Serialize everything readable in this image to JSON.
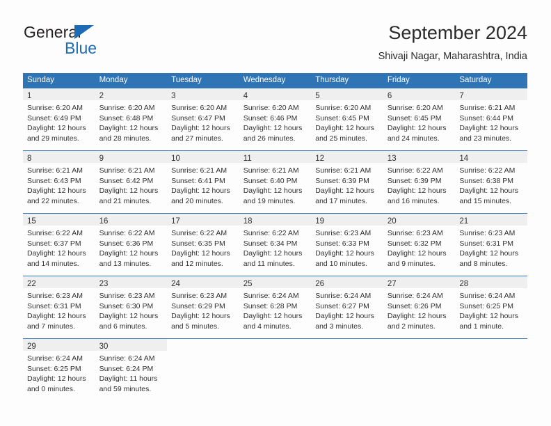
{
  "brand": {
    "name_part1": "General",
    "name_part2": "Blue",
    "flag_icon": "triangle-flag-icon",
    "accent_color": "#1d6cb5"
  },
  "header": {
    "title": "September 2024",
    "subtitle": "Shivaji Nagar, Maharashtra, India"
  },
  "theme": {
    "header_row_bg": "#2f74b5",
    "daynum_bg": "#efefef",
    "text_color": "#303030",
    "page_bg": "#fdfdfd"
  },
  "weekday_headers": [
    "Sunday",
    "Monday",
    "Tuesday",
    "Wednesday",
    "Thursday",
    "Friday",
    "Saturday"
  ],
  "labels": {
    "sunrise_prefix": "Sunrise:",
    "sunset_prefix": "Sunset:",
    "daylight_prefix": "Daylight:"
  },
  "weeks": [
    [
      {
        "day": "1",
        "sunrise": "Sunrise: 6:20 AM",
        "sunset": "Sunset: 6:49 PM",
        "daylight_l1": "Daylight: 12 hours",
        "daylight_l2": "and 29 minutes."
      },
      {
        "day": "2",
        "sunrise": "Sunrise: 6:20 AM",
        "sunset": "Sunset: 6:48 PM",
        "daylight_l1": "Daylight: 12 hours",
        "daylight_l2": "and 28 minutes."
      },
      {
        "day": "3",
        "sunrise": "Sunrise: 6:20 AM",
        "sunset": "Sunset: 6:47 PM",
        "daylight_l1": "Daylight: 12 hours",
        "daylight_l2": "and 27 minutes."
      },
      {
        "day": "4",
        "sunrise": "Sunrise: 6:20 AM",
        "sunset": "Sunset: 6:46 PM",
        "daylight_l1": "Daylight: 12 hours",
        "daylight_l2": "and 26 minutes."
      },
      {
        "day": "5",
        "sunrise": "Sunrise: 6:20 AM",
        "sunset": "Sunset: 6:45 PM",
        "daylight_l1": "Daylight: 12 hours",
        "daylight_l2": "and 25 minutes."
      },
      {
        "day": "6",
        "sunrise": "Sunrise: 6:20 AM",
        "sunset": "Sunset: 6:45 PM",
        "daylight_l1": "Daylight: 12 hours",
        "daylight_l2": "and 24 minutes."
      },
      {
        "day": "7",
        "sunrise": "Sunrise: 6:21 AM",
        "sunset": "Sunset: 6:44 PM",
        "daylight_l1": "Daylight: 12 hours",
        "daylight_l2": "and 23 minutes."
      }
    ],
    [
      {
        "day": "8",
        "sunrise": "Sunrise: 6:21 AM",
        "sunset": "Sunset: 6:43 PM",
        "daylight_l1": "Daylight: 12 hours",
        "daylight_l2": "and 22 minutes."
      },
      {
        "day": "9",
        "sunrise": "Sunrise: 6:21 AM",
        "sunset": "Sunset: 6:42 PM",
        "daylight_l1": "Daylight: 12 hours",
        "daylight_l2": "and 21 minutes."
      },
      {
        "day": "10",
        "sunrise": "Sunrise: 6:21 AM",
        "sunset": "Sunset: 6:41 PM",
        "daylight_l1": "Daylight: 12 hours",
        "daylight_l2": "and 20 minutes."
      },
      {
        "day": "11",
        "sunrise": "Sunrise: 6:21 AM",
        "sunset": "Sunset: 6:40 PM",
        "daylight_l1": "Daylight: 12 hours",
        "daylight_l2": "and 19 minutes."
      },
      {
        "day": "12",
        "sunrise": "Sunrise: 6:21 AM",
        "sunset": "Sunset: 6:39 PM",
        "daylight_l1": "Daylight: 12 hours",
        "daylight_l2": "and 17 minutes."
      },
      {
        "day": "13",
        "sunrise": "Sunrise: 6:22 AM",
        "sunset": "Sunset: 6:39 PM",
        "daylight_l1": "Daylight: 12 hours",
        "daylight_l2": "and 16 minutes."
      },
      {
        "day": "14",
        "sunrise": "Sunrise: 6:22 AM",
        "sunset": "Sunset: 6:38 PM",
        "daylight_l1": "Daylight: 12 hours",
        "daylight_l2": "and 15 minutes."
      }
    ],
    [
      {
        "day": "15",
        "sunrise": "Sunrise: 6:22 AM",
        "sunset": "Sunset: 6:37 PM",
        "daylight_l1": "Daylight: 12 hours",
        "daylight_l2": "and 14 minutes."
      },
      {
        "day": "16",
        "sunrise": "Sunrise: 6:22 AM",
        "sunset": "Sunset: 6:36 PM",
        "daylight_l1": "Daylight: 12 hours",
        "daylight_l2": "and 13 minutes."
      },
      {
        "day": "17",
        "sunrise": "Sunrise: 6:22 AM",
        "sunset": "Sunset: 6:35 PM",
        "daylight_l1": "Daylight: 12 hours",
        "daylight_l2": "and 12 minutes."
      },
      {
        "day": "18",
        "sunrise": "Sunrise: 6:22 AM",
        "sunset": "Sunset: 6:34 PM",
        "daylight_l1": "Daylight: 12 hours",
        "daylight_l2": "and 11 minutes."
      },
      {
        "day": "19",
        "sunrise": "Sunrise: 6:23 AM",
        "sunset": "Sunset: 6:33 PM",
        "daylight_l1": "Daylight: 12 hours",
        "daylight_l2": "and 10 minutes."
      },
      {
        "day": "20",
        "sunrise": "Sunrise: 6:23 AM",
        "sunset": "Sunset: 6:32 PM",
        "daylight_l1": "Daylight: 12 hours",
        "daylight_l2": "and 9 minutes."
      },
      {
        "day": "21",
        "sunrise": "Sunrise: 6:23 AM",
        "sunset": "Sunset: 6:31 PM",
        "daylight_l1": "Daylight: 12 hours",
        "daylight_l2": "and 8 minutes."
      }
    ],
    [
      {
        "day": "22",
        "sunrise": "Sunrise: 6:23 AM",
        "sunset": "Sunset: 6:31 PM",
        "daylight_l1": "Daylight: 12 hours",
        "daylight_l2": "and 7 minutes."
      },
      {
        "day": "23",
        "sunrise": "Sunrise: 6:23 AM",
        "sunset": "Sunset: 6:30 PM",
        "daylight_l1": "Daylight: 12 hours",
        "daylight_l2": "and 6 minutes."
      },
      {
        "day": "24",
        "sunrise": "Sunrise: 6:23 AM",
        "sunset": "Sunset: 6:29 PM",
        "daylight_l1": "Daylight: 12 hours",
        "daylight_l2": "and 5 minutes."
      },
      {
        "day": "25",
        "sunrise": "Sunrise: 6:24 AM",
        "sunset": "Sunset: 6:28 PM",
        "daylight_l1": "Daylight: 12 hours",
        "daylight_l2": "and 4 minutes."
      },
      {
        "day": "26",
        "sunrise": "Sunrise: 6:24 AM",
        "sunset": "Sunset: 6:27 PM",
        "daylight_l1": "Daylight: 12 hours",
        "daylight_l2": "and 3 minutes."
      },
      {
        "day": "27",
        "sunrise": "Sunrise: 6:24 AM",
        "sunset": "Sunset: 6:26 PM",
        "daylight_l1": "Daylight: 12 hours",
        "daylight_l2": "and 2 minutes."
      },
      {
        "day": "28",
        "sunrise": "Sunrise: 6:24 AM",
        "sunset": "Sunset: 6:25 PM",
        "daylight_l1": "Daylight: 12 hours",
        "daylight_l2": "and 1 minute."
      }
    ],
    [
      {
        "day": "29",
        "sunrise": "Sunrise: 6:24 AM",
        "sunset": "Sunset: 6:25 PM",
        "daylight_l1": "Daylight: 12 hours",
        "daylight_l2": "and 0 minutes."
      },
      {
        "day": "30",
        "sunrise": "Sunrise: 6:24 AM",
        "sunset": "Sunset: 6:24 PM",
        "daylight_l1": "Daylight: 11 hours",
        "daylight_l2": "and 59 minutes."
      },
      null,
      null,
      null,
      null,
      null
    ]
  ]
}
